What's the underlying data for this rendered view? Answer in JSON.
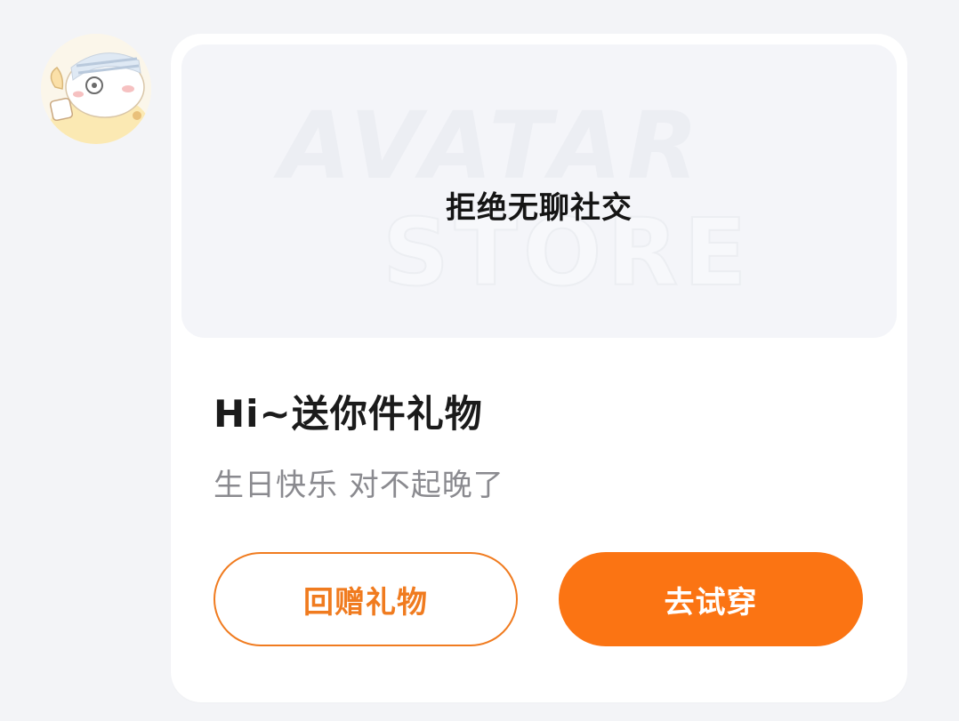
{
  "avatar": {
    "icon": "cat-avatar-icon"
  },
  "gift_card": {
    "banner": {
      "watermark_line1": "AVATAR",
      "watermark_line2": "STORE",
      "text": "拒绝无聊社交"
    },
    "title": "Hi~送你件礼物",
    "message": "生日快乐 对不起晚了",
    "buttons": {
      "return_gift": "回赠礼物",
      "try_on": "去试穿"
    }
  },
  "colors": {
    "accent": "#fb7413",
    "outline": "#f07b1f",
    "page_background": "#f3f4f7",
    "banner_background": "#f4f5f9"
  }
}
